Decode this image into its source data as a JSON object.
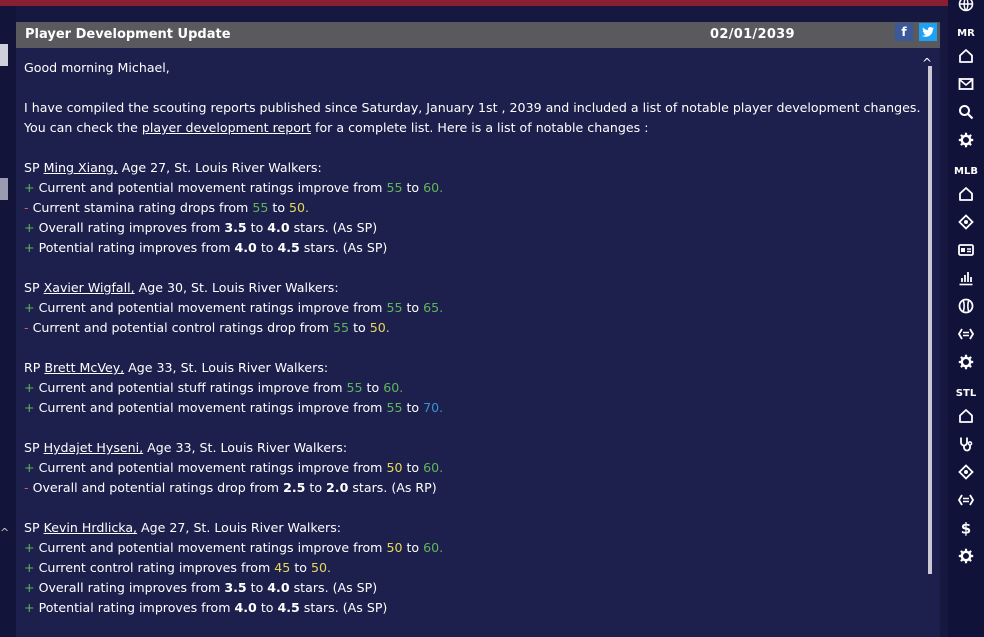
{
  "panel": {
    "title": "Player Development Update",
    "date": "02/01/2039",
    "share_facebook": "f",
    "share_twitter": "t"
  },
  "message": {
    "greeting": "Good morning Michael,",
    "intro_line1": "I have compiled the scouting reports published since Saturday, January 1st , 2039 and included a list of notable player development changes.",
    "intro_line2_pre": "You can check the ",
    "intro_link": "player development report",
    "intro_line2_post": " for a complete list. Here is a list of notable changes :"
  },
  "players": [
    {
      "pos": "SP",
      "name": "Ming Xiang,",
      "info": " Age 27, St. Louis River Walkers:",
      "changes": [
        {
          "sign": "+",
          "text": "Current and potential movement ratings improve from ",
          "from": "55",
          "to": "60.",
          "from_color": "g",
          "to_color": "g",
          "bold_values": false,
          "suffix": ""
        },
        {
          "sign": "-",
          "text": "Current stamina rating drops from ",
          "from": "55",
          "to": "50.",
          "from_color": "g",
          "to_color": "y",
          "bold_values": false,
          "suffix": ""
        },
        {
          "sign": "+",
          "text": "Overall rating improves from ",
          "from": "3.5",
          "to": "4.0",
          "from_color": "",
          "to_color": "",
          "bold_values": true,
          "suffix": " stars. (As SP)"
        },
        {
          "sign": "+",
          "text": "Potential rating improves from ",
          "from": "4.0",
          "to": "4.5",
          "from_color": "",
          "to_color": "",
          "bold_values": true,
          "suffix": " stars. (As SP)"
        }
      ]
    },
    {
      "pos": "SP",
      "name": "Xavier Wigfall,",
      "info": " Age 30, St. Louis River Walkers:",
      "changes": [
        {
          "sign": "+",
          "text": "Current and potential movement ratings improve from ",
          "from": "55",
          "to": "65.",
          "from_color": "g",
          "to_color": "g",
          "bold_values": false,
          "suffix": ""
        },
        {
          "sign": "-",
          "text": "Current and potential control ratings drop from ",
          "from": "55",
          "to": "50.",
          "from_color": "g",
          "to_color": "y",
          "bold_values": false,
          "suffix": ""
        }
      ]
    },
    {
      "pos": "RP",
      "name": "Brett McVey,",
      "info": " Age 33, St. Louis River Walkers:",
      "changes": [
        {
          "sign": "+",
          "text": "Current and potential stuff ratings improve from ",
          "from": "55",
          "to": "60.",
          "from_color": "g",
          "to_color": "g",
          "bold_values": false,
          "suffix": ""
        },
        {
          "sign": "+",
          "text": "Current and potential movement ratings improve from ",
          "from": "55",
          "to": "70.",
          "from_color": "g",
          "to_color": "b",
          "bold_values": false,
          "suffix": ""
        }
      ]
    },
    {
      "pos": "SP",
      "name": "Hydajet Hyseni,",
      "info": " Age 33, St. Louis River Walkers:",
      "changes": [
        {
          "sign": "+",
          "text": "Current and potential movement ratings improve from ",
          "from": "50",
          "to": "60.",
          "from_color": "y",
          "to_color": "g",
          "bold_values": false,
          "suffix": ""
        },
        {
          "sign": "-",
          "text": "Overall and potential ratings drop from ",
          "from": "2.5",
          "to": "2.0",
          "from_color": "",
          "to_color": "",
          "bold_values": true,
          "suffix": " stars. (As RP)"
        }
      ]
    },
    {
      "pos": "SP",
      "name": "Kevin Hrdlicka,",
      "info": " Age 27, St. Louis River Walkers:",
      "changes": [
        {
          "sign": "+",
          "text": "Current and potential movement ratings improve from ",
          "from": "50",
          "to": "60.",
          "from_color": "y",
          "to_color": "g",
          "bold_values": false,
          "suffix": ""
        },
        {
          "sign": "+",
          "text": "Current control rating improves from ",
          "from": "45",
          "to": "50.",
          "from_color": "y",
          "to_color": "y",
          "bold_values": false,
          "suffix": ""
        },
        {
          "sign": "+",
          "text": "Overall rating improves from ",
          "from": "3.5",
          "to": "4.0",
          "from_color": "",
          "to_color": "",
          "bold_values": true,
          "suffix": " stars. (As SP)"
        },
        {
          "sign": "+",
          "text": "Potential rating improves from ",
          "from": "4.0",
          "to": "4.5",
          "from_color": "",
          "to_color": "",
          "bold_values": true,
          "suffix": " stars. (As SP)"
        }
      ]
    }
  ],
  "connector": "to",
  "sidebar": {
    "sections": [
      {
        "label": "MR",
        "icons": [
          "home-icon",
          "mail-icon",
          "search-icon",
          "gear-icon"
        ]
      },
      {
        "label": "MLB",
        "icons": [
          "home-icon",
          "location-icon",
          "id-card-icon",
          "chart-icon",
          "baseball-icon",
          "transactions-icon",
          "gear-icon"
        ]
      },
      {
        "label": "STL",
        "icons": [
          "home-icon",
          "medical-icon",
          "location-icon",
          "transactions-icon",
          "dollar-icon",
          "gear-icon"
        ]
      }
    ]
  },
  "colors": {
    "green": "#5fb55a",
    "yellow": "#e6d85c",
    "blue": "#3b8fd1",
    "red": "#e05a5a",
    "header": "#5a5a5e",
    "panel": "#1d1f4d",
    "topbar": "#8a1f33"
  }
}
